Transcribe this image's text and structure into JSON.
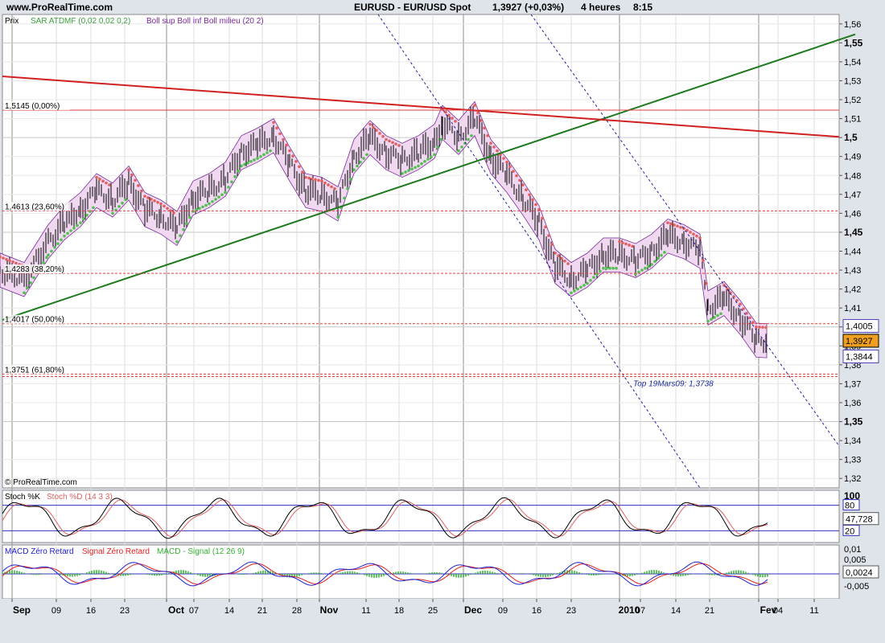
{
  "header": {
    "site": "www.ProRealTime.com",
    "instrument": "EURUSD - EUR/USD Spot",
    "quote": "1,3927 (+0,03%)",
    "timeframe": "4 heures",
    "time": "8:15"
  },
  "chart_data": [
    {
      "type": "line",
      "panel": "price",
      "legend": {
        "prix": "Prix",
        "sar": "SAR ATDMF (0,02 0,02 0,2)",
        "boll": "Boll sup Boll inf Boll milieu (20 2)"
      },
      "ylim": [
        1.315,
        1.565
      ],
      "y_ticks": [
        "1,56",
        "1,55",
        "1,54",
        "1,53",
        "1,52",
        "1,51",
        "1,5",
        "1,49",
        "1,48",
        "1,47",
        "1,46",
        "1,45",
        "1,44",
        "1,43",
        "1,42",
        "1,41",
        "1,4",
        "1,39",
        "1,38",
        "1,37",
        "1,36",
        "1,35",
        "1,34",
        "1,33",
        "1,32"
      ],
      "y_ticks_bold": [
        "1,55",
        "1,5",
        "1,45",
        "1,4",
        "1,35"
      ],
      "x_ticks": [
        "Sep",
        "09",
        "16",
        "23",
        "Oct",
        "07",
        "14",
        "21",
        "28",
        "Nov",
        "11",
        "18",
        "25",
        "Dec",
        "09",
        "16",
        "23",
        "2010",
        "07",
        "14",
        "21",
        "Fev",
        "04",
        "11"
      ],
      "x_ticks_bold": [
        "Sep",
        "Oct",
        "Nov",
        "Dec",
        "2010",
        "Fev"
      ],
      "close_path": [
        [
          0,
          1.43
        ],
        [
          30,
          1.425
        ],
        [
          60,
          1.445
        ],
        [
          80,
          1.455
        ],
        [
          100,
          1.462
        ],
        [
          120,
          1.472
        ],
        [
          140,
          1.467
        ],
        [
          160,
          1.476
        ],
        [
          180,
          1.462
        ],
        [
          200,
          1.458
        ],
        [
          220,
          1.452
        ],
        [
          240,
          1.468
        ],
        [
          260,
          1.472
        ],
        [
          280,
          1.478
        ],
        [
          300,
          1.492
        ],
        [
          320,
          1.496
        ],
        [
          340,
          1.501
        ],
        [
          360,
          1.486
        ],
        [
          380,
          1.472
        ],
        [
          400,
          1.47
        ],
        [
          420,
          1.465
        ],
        [
          440,
          1.49
        ],
        [
          460,
          1.5
        ],
        [
          480,
          1.492
        ],
        [
          500,
          1.488
        ],
        [
          520,
          1.492
        ],
        [
          540,
          1.498
        ],
        [
          550,
          1.508
        ],
        [
          570,
          1.5
        ],
        [
          590,
          1.51
        ],
        [
          610,
          1.49
        ],
        [
          630,
          1.48
        ],
        [
          650,
          1.468
        ],
        [
          670,
          1.455
        ],
        [
          690,
          1.432
        ],
        [
          710,
          1.425
        ],
        [
          730,
          1.43
        ],
        [
          750,
          1.438
        ],
        [
          770,
          1.438
        ],
        [
          790,
          1.435
        ],
        [
          810,
          1.44
        ],
        [
          830,
          1.448
        ],
        [
          850,
          1.445
        ],
        [
          870,
          1.44
        ],
        [
          880,
          1.41
        ],
        [
          900,
          1.415
        ],
        [
          920,
          1.405
        ],
        [
          940,
          1.393
        ],
        [
          953,
          1.3927
        ]
      ],
      "fib_levels": [
        {
          "label": "1,5145 (0,00%)",
          "value": 1.5145
        },
        {
          "label": "1,4613 (23,60%)",
          "value": 1.4613
        },
        {
          "label": "1,4283 (38,20%)",
          "value": 1.4283
        },
        {
          "label": "1,4017 (50,00%)",
          "value": 1.4017
        },
        {
          "label": "1,3751 (61,80%)",
          "value": 1.3751
        },
        {
          "label": "",
          "value": 1.3738
        }
      ],
      "annotation": "Top 19Mars09: 1,3738",
      "right_labels": [
        {
          "text": "1,4005",
          "value": 1.4005,
          "color": "#5040c0",
          "fill": "#ffffff"
        },
        {
          "text": "1,3927",
          "value": 1.3927,
          "color": "#000000",
          "fill": "#f0a020"
        },
        {
          "text": "1,3844",
          "value": 1.3844,
          "color": "#5040c0",
          "fill": "#ffffff"
        }
      ],
      "copyright": "© ProRealTime.com",
      "colors": {
        "sar_up": "#4fc04f",
        "sar_down": "#e06060",
        "boll": "#7b2a9a",
        "boll_fill": "#f0d8f0",
        "green_trend": "#1e7a1e",
        "red_trend": "#d02020",
        "fib": "#e04040",
        "channel": "#2020a0"
      }
    },
    {
      "type": "line",
      "panel": "stochastic",
      "legend": {
        "k": "Stoch %K",
        "d": "Stoch %D (14 3 3)"
      },
      "ylim": [
        0,
        100
      ],
      "levels": [
        20,
        80
      ],
      "y_ticks": [
        "100",
        "80",
        "20"
      ],
      "last_value": "47,728",
      "colors": {
        "k": "#000000",
        "d": "#e06060",
        "level": "#3030c0"
      }
    },
    {
      "type": "line",
      "panel": "macd",
      "legend": {
        "macd": "MACD Zéro Retard",
        "signal": "Signal Zéro Retard",
        "hist": "MACD - Signal (12 26 9)"
      },
      "y_ticks": [
        "0,01",
        "0,005",
        "-0,005"
      ],
      "last_value": "0,0024",
      "colors": {
        "macd": "#2020d0",
        "signal": "#e02020",
        "hist": "#30b030"
      }
    }
  ]
}
